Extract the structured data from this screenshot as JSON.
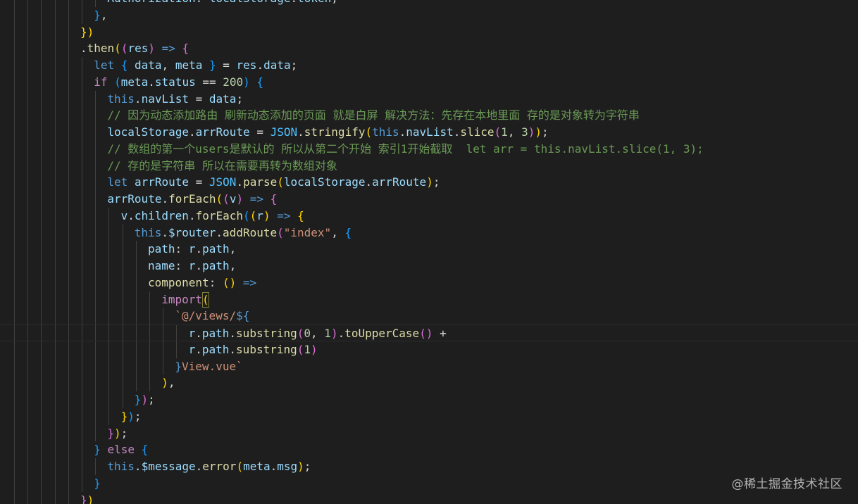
{
  "watermark": "@稀土掘金技术社区",
  "colors": {
    "background": "#1e1e1e",
    "keyword": "#569cd6",
    "control": "#c586c0",
    "variable": "#9cdcfe",
    "function": "#dcdcaa",
    "number": "#b5cea8",
    "string": "#ce9178",
    "comment": "#6a9955",
    "bracket1": "#ffd700",
    "bracket2": "#da70d6",
    "bracket3": "#179fff"
  },
  "editor": {
    "lines": [
      {
        "indent": 7,
        "tokens": [
          [
            "t-var",
            "Authorization"
          ],
          [
            "t-text",
            ": "
          ],
          [
            "t-var",
            "localStorage"
          ],
          [
            "t-text",
            "."
          ],
          [
            "t-var",
            "token"
          ],
          [
            "t-text",
            ","
          ]
        ]
      },
      {
        "indent": 6,
        "tokens": [
          [
            "t-p3",
            "}"
          ],
          [
            "t-text",
            ","
          ]
        ]
      },
      {
        "indent": 5,
        "tokens": [
          [
            "t-p1",
            "}"
          ],
          [
            "t-p1",
            ")"
          ]
        ]
      },
      {
        "indent": 5,
        "tokens": [
          [
            "t-text",
            "."
          ],
          [
            "t-fn",
            "then"
          ],
          [
            "t-p1",
            "("
          ],
          [
            "t-p2",
            "("
          ],
          [
            "t-var",
            "res"
          ],
          [
            "t-p2",
            ")"
          ],
          [
            "t-text",
            " "
          ],
          [
            "t-kw",
            "=>"
          ],
          [
            "t-text",
            " "
          ],
          [
            "t-p2",
            "{"
          ]
        ]
      },
      {
        "indent": 6,
        "tokens": [
          [
            "t-kw",
            "let"
          ],
          [
            "t-text",
            " "
          ],
          [
            "t-p3",
            "{"
          ],
          [
            "t-text",
            " "
          ],
          [
            "t-var",
            "data"
          ],
          [
            "t-text",
            ", "
          ],
          [
            "t-var",
            "meta"
          ],
          [
            "t-text",
            " "
          ],
          [
            "t-p3",
            "}"
          ],
          [
            "t-text",
            " = "
          ],
          [
            "t-var",
            "res"
          ],
          [
            "t-text",
            "."
          ],
          [
            "t-var",
            "data"
          ],
          [
            "t-text",
            ";"
          ]
        ]
      },
      {
        "indent": 6,
        "tokens": [
          [
            "t-ctl",
            "if"
          ],
          [
            "t-text",
            " "
          ],
          [
            "t-p3",
            "("
          ],
          [
            "t-var",
            "meta"
          ],
          [
            "t-text",
            "."
          ],
          [
            "t-var",
            "status"
          ],
          [
            "t-text",
            " == "
          ],
          [
            "t-num",
            "200"
          ],
          [
            "t-p3",
            ")"
          ],
          [
            "t-text",
            " "
          ],
          [
            "t-p3",
            "{"
          ]
        ]
      },
      {
        "indent": 7,
        "tokens": [
          [
            "t-kw",
            "this"
          ],
          [
            "t-text",
            "."
          ],
          [
            "t-var",
            "navList"
          ],
          [
            "t-text",
            " = "
          ],
          [
            "t-var",
            "data"
          ],
          [
            "t-text",
            ";"
          ]
        ]
      },
      {
        "indent": 7,
        "tokens": [
          [
            "t-cmt",
            "// 因为动态添加路由 刷新动态添加的页面 就是白屏 解决方法：先存在本地里面 存的是对象转为字符串"
          ]
        ]
      },
      {
        "indent": 7,
        "tokens": [
          [
            "t-var",
            "localStorage"
          ],
          [
            "t-text",
            "."
          ],
          [
            "t-var",
            "arrRoute"
          ],
          [
            "t-text",
            " = "
          ],
          [
            "t-const",
            "JSON"
          ],
          [
            "t-text",
            "."
          ],
          [
            "t-fn",
            "stringify"
          ],
          [
            "t-p1",
            "("
          ],
          [
            "t-kw",
            "this"
          ],
          [
            "t-text",
            "."
          ],
          [
            "t-var",
            "navList"
          ],
          [
            "t-text",
            "."
          ],
          [
            "t-fn",
            "slice"
          ],
          [
            "t-p2",
            "("
          ],
          [
            "t-num",
            "1"
          ],
          [
            "t-text",
            ", "
          ],
          [
            "t-num",
            "3"
          ],
          [
            "t-p2",
            ")"
          ],
          [
            "t-p1",
            ")"
          ],
          [
            "t-text",
            ";"
          ]
        ]
      },
      {
        "indent": 7,
        "tokens": [
          [
            "t-cmt",
            "// 数组的第一个users是默认的 所以从第二个开始 索引1开始截取  let arr = this.navList.slice(1, 3);"
          ]
        ]
      },
      {
        "indent": 7,
        "tokens": [
          [
            "t-cmt",
            "// 存的是字符串 所以在需要再转为数组对象"
          ]
        ]
      },
      {
        "indent": 7,
        "tokens": [
          [
            "t-kw",
            "let"
          ],
          [
            "t-text",
            " "
          ],
          [
            "t-var",
            "arrRoute"
          ],
          [
            "t-text",
            " = "
          ],
          [
            "t-const",
            "JSON"
          ],
          [
            "t-text",
            "."
          ],
          [
            "t-fn",
            "parse"
          ],
          [
            "t-p1",
            "("
          ],
          [
            "t-var",
            "localStorage"
          ],
          [
            "t-text",
            "."
          ],
          [
            "t-var",
            "arrRoute"
          ],
          [
            "t-p1",
            ")"
          ],
          [
            "t-text",
            ";"
          ]
        ]
      },
      {
        "indent": 7,
        "tokens": [
          [
            "t-var",
            "arrRoute"
          ],
          [
            "t-text",
            "."
          ],
          [
            "t-fn",
            "forEach"
          ],
          [
            "t-p1",
            "("
          ],
          [
            "t-p2",
            "("
          ],
          [
            "t-var",
            "v"
          ],
          [
            "t-p2",
            ")"
          ],
          [
            "t-text",
            " "
          ],
          [
            "t-kw",
            "=>"
          ],
          [
            "t-text",
            " "
          ],
          [
            "t-p2",
            "{"
          ]
        ]
      },
      {
        "indent": 8,
        "tokens": [
          [
            "t-var",
            "v"
          ],
          [
            "t-text",
            "."
          ],
          [
            "t-var",
            "children"
          ],
          [
            "t-text",
            "."
          ],
          [
            "t-fn",
            "forEach"
          ],
          [
            "t-p3",
            "("
          ],
          [
            "t-p1",
            "("
          ],
          [
            "t-var",
            "r"
          ],
          [
            "t-p1",
            ")"
          ],
          [
            "t-text",
            " "
          ],
          [
            "t-kw",
            "=>"
          ],
          [
            "t-text",
            " "
          ],
          [
            "t-p1",
            "{"
          ]
        ]
      },
      {
        "indent": 9,
        "tokens": [
          [
            "t-kw",
            "this"
          ],
          [
            "t-text",
            "."
          ],
          [
            "t-var",
            "$router"
          ],
          [
            "t-text",
            "."
          ],
          [
            "t-fn",
            "addRoute"
          ],
          [
            "t-p2",
            "("
          ],
          [
            "t-str",
            "\"index\""
          ],
          [
            "t-text",
            ", "
          ],
          [
            "t-p3",
            "{"
          ]
        ]
      },
      {
        "indent": 10,
        "tokens": [
          [
            "t-var",
            "path"
          ],
          [
            "t-text",
            ": "
          ],
          [
            "t-var",
            "r"
          ],
          [
            "t-text",
            "."
          ],
          [
            "t-var",
            "path"
          ],
          [
            "t-text",
            ","
          ]
        ]
      },
      {
        "indent": 10,
        "tokens": [
          [
            "t-var",
            "name"
          ],
          [
            "t-text",
            ": "
          ],
          [
            "t-var",
            "r"
          ],
          [
            "t-text",
            "."
          ],
          [
            "t-var",
            "path"
          ],
          [
            "t-text",
            ","
          ]
        ]
      },
      {
        "indent": 10,
        "tokens": [
          [
            "t-fn",
            "component"
          ],
          [
            "t-text",
            ": "
          ],
          [
            "t-p1",
            "("
          ],
          [
            "t-p1",
            ")"
          ],
          [
            "t-text",
            " "
          ],
          [
            "t-kw",
            "=>"
          ]
        ]
      },
      {
        "indent": 11,
        "tokens": [
          [
            "t-ctl",
            "import"
          ],
          [
            "t-p1",
            "("
          ]
        ]
      },
      {
        "indent": 12,
        "tokens": [
          [
            "t-str",
            "`@/views/"
          ],
          [
            "t-kw",
            "${"
          ]
        ]
      },
      {
        "indent": 13,
        "current": true,
        "tokens": [
          [
            "t-var",
            "r"
          ],
          [
            "t-text",
            "."
          ],
          [
            "t-var",
            "path"
          ],
          [
            "t-text",
            "."
          ],
          [
            "t-fn",
            "substring"
          ],
          [
            "t-p2",
            "("
          ],
          [
            "t-num",
            "0"
          ],
          [
            "t-text",
            ", "
          ],
          [
            "t-num",
            "1"
          ],
          [
            "t-p2",
            ")"
          ],
          [
            "t-text",
            "."
          ],
          [
            "t-fn",
            "toUpperCase"
          ],
          [
            "t-p2",
            "("
          ],
          [
            "t-p2",
            ")"
          ],
          [
            "t-text",
            " +"
          ]
        ]
      },
      {
        "indent": 13,
        "tokens": [
          [
            "t-var",
            "r"
          ],
          [
            "t-text",
            "."
          ],
          [
            "t-var",
            "path"
          ],
          [
            "t-text",
            "."
          ],
          [
            "t-fn",
            "substring"
          ],
          [
            "t-p2",
            "("
          ],
          [
            "t-num",
            "1"
          ],
          [
            "t-p2",
            ")"
          ]
        ]
      },
      {
        "indent": 12,
        "tokens": [
          [
            "t-kw",
            "}"
          ],
          [
            "t-str",
            "View.vue`"
          ]
        ]
      },
      {
        "indent": 11,
        "tokens": [
          [
            "t-p1",
            ")"
          ],
          [
            "t-text",
            ","
          ]
        ]
      },
      {
        "indent": 9,
        "tokens": [
          [
            "t-p3",
            "}"
          ],
          [
            "t-p2",
            ")"
          ],
          [
            "t-text",
            ";"
          ]
        ]
      },
      {
        "indent": 8,
        "tokens": [
          [
            "t-p1",
            "}"
          ],
          [
            "t-p3",
            ")"
          ],
          [
            "t-text",
            ";"
          ]
        ]
      },
      {
        "indent": 7,
        "tokens": [
          [
            "t-p2",
            "}"
          ],
          [
            "t-p1",
            ")"
          ],
          [
            "t-text",
            ";"
          ]
        ]
      },
      {
        "indent": 6,
        "tokens": [
          [
            "t-p3",
            "}"
          ],
          [
            "t-text",
            " "
          ],
          [
            "t-ctl",
            "else"
          ],
          [
            "t-text",
            " "
          ],
          [
            "t-p3",
            "{"
          ]
        ]
      },
      {
        "indent": 7,
        "tokens": [
          [
            "t-kw",
            "this"
          ],
          [
            "t-text",
            "."
          ],
          [
            "t-var",
            "$message"
          ],
          [
            "t-text",
            "."
          ],
          [
            "t-fn",
            "error"
          ],
          [
            "t-p1",
            "("
          ],
          [
            "t-var",
            "meta"
          ],
          [
            "t-text",
            "."
          ],
          [
            "t-var",
            "msg"
          ],
          [
            "t-p1",
            ")"
          ],
          [
            "t-text",
            ";"
          ]
        ]
      },
      {
        "indent": 6,
        "tokens": [
          [
            "t-p3",
            "}"
          ]
        ]
      },
      {
        "indent": 5,
        "tokens": [
          [
            "t-p2",
            "}"
          ],
          [
            "t-p1",
            ")"
          ]
        ]
      }
    ]
  }
}
